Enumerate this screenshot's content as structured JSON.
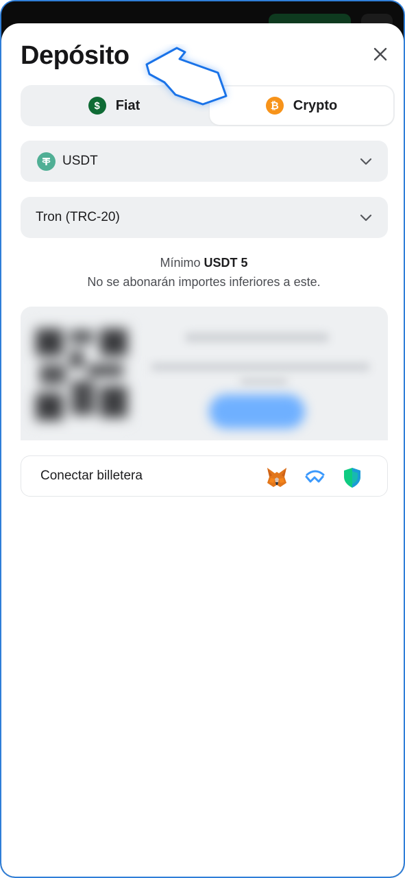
{
  "modal": {
    "title": "Depósito"
  },
  "tabs": [
    {
      "label": "Fiat",
      "icon": "dollar-coin-icon",
      "selected": false
    },
    {
      "label": "Crypto",
      "icon": "bitcoin-icon",
      "selected": true
    }
  ],
  "asset_select": {
    "value": "USDT",
    "icon": "tether-icon"
  },
  "network_select": {
    "value": "Tron (TRC-20)"
  },
  "minimum": {
    "prefix": "Mínimo",
    "amount": "USDT 5",
    "note": "No se abonarán importes inferiores a este."
  },
  "wallet": {
    "label": "Conectar billetera",
    "icons": [
      "metamask-icon",
      "walletconnect-icon",
      "trust-wallet-icon"
    ]
  },
  "colors": {
    "accent_frame": "#2f7ed8",
    "fiat_coin": "#0f6b35",
    "crypto_coin": "#f7931a",
    "tether": "#50af95"
  }
}
